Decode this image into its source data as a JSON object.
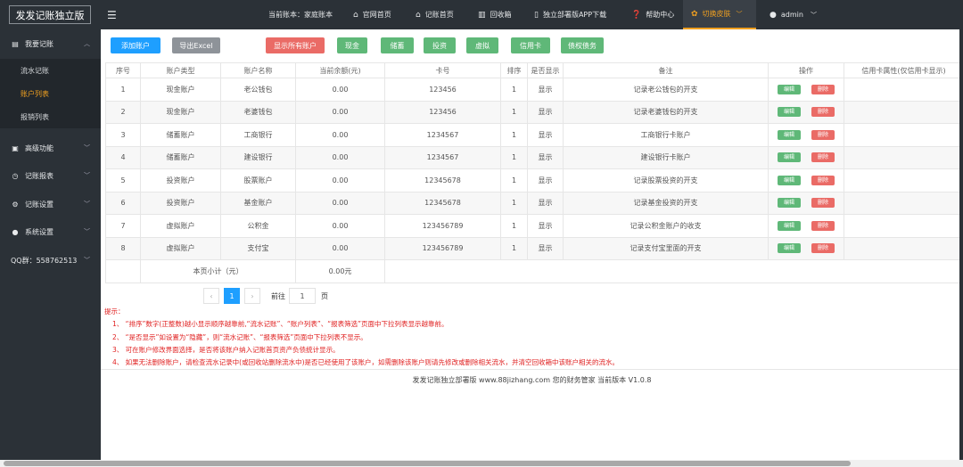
{
  "sidebar": {
    "logo": "发发记账独立版",
    "groups": [
      {
        "label": "我要记账",
        "icon": "document-icon",
        "expanded": true
      },
      {
        "label": "高级功能",
        "icon": "box-icon"
      },
      {
        "label": "记账报表",
        "icon": "clock-icon"
      },
      {
        "label": "记账设置",
        "icon": "gear-icon"
      },
      {
        "label": "系统设置",
        "icon": "user-icon"
      },
      {
        "label": "QQ群：558762513"
      }
    ],
    "subitems": [
      "流水记账",
      "账户列表",
      "报销列表"
    ],
    "active_subitem": "账户列表"
  },
  "topbar": {
    "current_book": "当前账本：家庭账本",
    "nav": [
      "官网首页",
      "记账首页",
      "回收箱",
      "独立部署版APP下载",
      "帮助中心",
      "切换皮肤",
      "admin"
    ]
  },
  "toolbar": {
    "add": "添加账户",
    "export": "导出Excel",
    "show_all": "显示所有账户",
    "filters": [
      "现金",
      "储蓄",
      "投资",
      "虚拟",
      "信用卡",
      "债权债务"
    ]
  },
  "table": {
    "headers": [
      "序号",
      "账户类型",
      "账户名称",
      "当前余额(元)",
      "卡号",
      "排序",
      "是否显示",
      "备注",
      "操作",
      "信用卡属性(仅信用卡显示)"
    ],
    "rows": [
      [
        "1",
        "现金账户",
        "老公钱包",
        "0.00",
        "123456",
        "1",
        "显示",
        "记录老公钱包的开支"
      ],
      [
        "2",
        "现金账户",
        "老婆钱包",
        "0.00",
        "123456",
        "1",
        "显示",
        "记录老婆钱包的开支"
      ],
      [
        "3",
        "储蓄账户",
        "工商银行",
        "0.00",
        "1234567",
        "1",
        "显示",
        "工商银行卡账户"
      ],
      [
        "4",
        "储蓄账户",
        "建设银行",
        "0.00",
        "1234567",
        "1",
        "显示",
        "建设银行卡账户"
      ],
      [
        "5",
        "投资账户",
        "股票账户",
        "0.00",
        "12345678",
        "1",
        "显示",
        "记录股票投资的开支"
      ],
      [
        "6",
        "投资账户",
        "基金账户",
        "0.00",
        "12345678",
        "1",
        "显示",
        "记录基金投资的开支"
      ],
      [
        "7",
        "虚拟账户",
        "公积金",
        "0.00",
        "123456789",
        "1",
        "显示",
        "记录公积金账户的收支"
      ],
      [
        "8",
        "虚拟账户",
        "支付宝",
        "0.00",
        "123456789",
        "1",
        "显示",
        "记录支付宝里面的开支"
      ]
    ],
    "edit_label": "编辑",
    "delete_label": "删除",
    "subtotal_label": "本页小计（元）",
    "subtotal_value": "0.00元"
  },
  "pager": {
    "prev": "‹",
    "current": "1",
    "next": "›",
    "goto_label": "前往",
    "page_value": "1",
    "page_suffix": "页"
  },
  "tips": {
    "title": "提示：",
    "lines": [
      "1、 “排序”数字(正整数)越小显示顺序越靠前,“流水记账”、“账户列表”、“报表筛选”页面中下拉列表显示越靠前。",
      "2、 “是否显示”如设置为“隐藏”，则“流水记账”、“报表筛选”页面中下拉列表不显示。",
      "3、 可在账户修改界面选择，是否将该账户纳入记账首页资产负债统计显示。",
      "4、 如果无法删除账户，请检查流水记录中(或回收站删除流水中)是否已经使用了该账户，如需删除该账户则请先修改或删除相关流水，并清空回收箱中该账户相关的流水。"
    ]
  },
  "footer": "发发记账独立部署版   www.88jizhang.com   您的财务管家   当前版本 V1.0.8",
  "colors": {
    "sidebar": "#2b3137",
    "accent": "#f0a020",
    "primary": "#1e9fff",
    "green": "#5fb878",
    "red": "#ea6b66"
  }
}
